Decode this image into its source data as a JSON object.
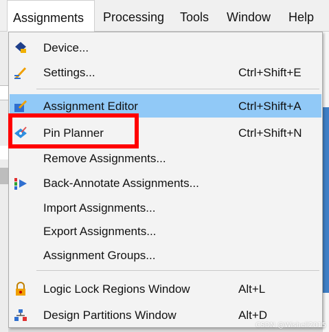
{
  "menubar": {
    "items": [
      {
        "label": "Assignments"
      },
      {
        "label": "Processing"
      },
      {
        "label": "Tools"
      },
      {
        "label": "Window"
      },
      {
        "label": "Help"
      }
    ]
  },
  "menu": {
    "items": [
      {
        "label": "Device...",
        "shortcut": "",
        "icon": "device-chip-icon"
      },
      {
        "label": "Settings...",
        "shortcut": "Ctrl+Shift+E",
        "icon": "settings-pencil-icon"
      },
      {
        "label": "Assignment Editor",
        "shortcut": "Ctrl+Shift+A",
        "icon": "assignment-editor-icon"
      },
      {
        "label": "Pin Planner",
        "shortcut": "Ctrl+Shift+N",
        "icon": "pin-planner-icon"
      },
      {
        "label": "Remove Assignments...",
        "shortcut": "",
        "icon": ""
      },
      {
        "label": "Back-Annotate Assignments...",
        "shortcut": "",
        "icon": "back-annotate-icon"
      },
      {
        "label": "Import Assignments...",
        "shortcut": "",
        "icon": ""
      },
      {
        "label": "Export Assignments...",
        "shortcut": "",
        "icon": ""
      },
      {
        "label": "Assignment Groups...",
        "shortcut": "",
        "icon": ""
      },
      {
        "label": "Logic Lock Regions Window",
        "shortcut": "Alt+L",
        "icon": "lock-icon"
      },
      {
        "label": "Design Partitions Window",
        "shortcut": "Alt+D",
        "icon": "partitions-icon"
      }
    ]
  },
  "colors": {
    "highlight": "#91c9f7",
    "annotation_box": "#ff0000"
  },
  "watermark": "CSDN @Wishell2015"
}
